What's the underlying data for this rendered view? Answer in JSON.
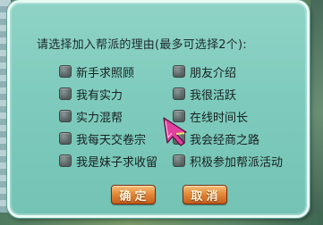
{
  "dialog": {
    "prompt": "请选择加入帮派的理由(最多可选择2个):"
  },
  "options": [
    {
      "label": "新手求照顾",
      "checked": false
    },
    {
      "label": "朋友介绍",
      "checked": false
    },
    {
      "label": "我有实力",
      "checked": false
    },
    {
      "label": "我很活跃",
      "checked": false
    },
    {
      "label": "实力混帮",
      "checked": false
    },
    {
      "label": "在线时间长",
      "checked": false
    },
    {
      "label": "我每天交卷宗",
      "checked": false
    },
    {
      "label": "我会经商之路",
      "checked": false
    },
    {
      "label": "我是妹子求收留",
      "checked": false
    },
    {
      "label": "积极参加帮派活动",
      "checked": false
    }
  ],
  "buttons": {
    "confirm": "确定",
    "cancel": "取消"
  },
  "colors": {
    "panel": "#7ecbbd",
    "button": "#e58a3a",
    "cursor": "#e040a0"
  },
  "icons": {
    "cursor": "arrow-cursor-icon"
  }
}
